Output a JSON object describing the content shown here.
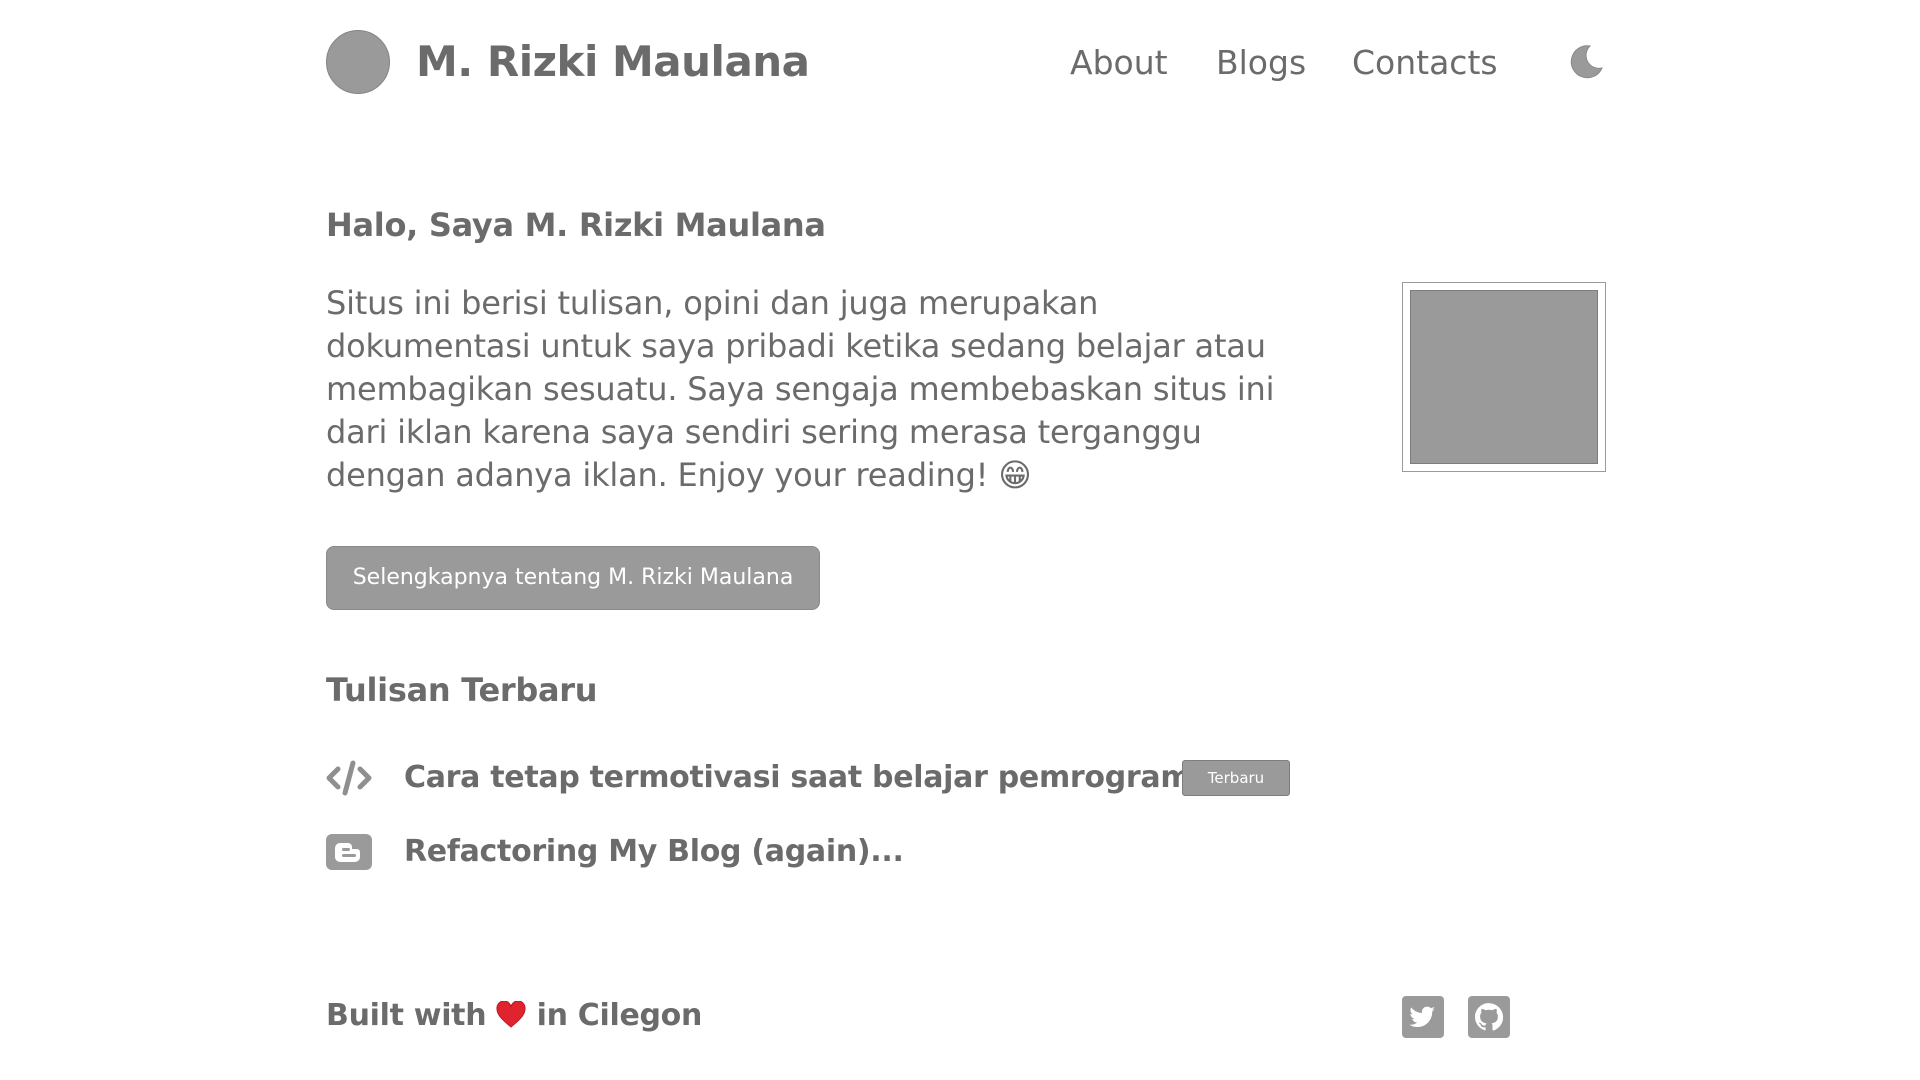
{
  "header": {
    "site_title": "M. Rizki Maulana",
    "nav": {
      "about": "About",
      "blogs": "Blogs",
      "contacts": "Contacts"
    },
    "theme_toggle_icon": "moon-icon"
  },
  "intro": {
    "heading": "Halo, Saya M. Rizki Maulana",
    "text": "Situs ini berisi tulisan, opini dan juga merupakan dokumentasi untuk saya pribadi ketika sedang belajar atau membagikan sesuatu. Saya sengaja membebaskan situs ini dari iklan karena saya sendiri sering merasa terganggu dengan adanya iklan. Enjoy your reading!",
    "emoji": "😁",
    "button_label": "Selengkapnya tentang M. Rizki Maulana"
  },
  "recent": {
    "heading": "Tulisan Terbaru",
    "posts": [
      {
        "icon": "code-icon",
        "title": "Cara tetap termotivasi saat belajar pemrograman",
        "badge": "Terbaru"
      },
      {
        "icon": "blogger-icon",
        "title": "Refactoring My Blog (again)..."
      }
    ]
  },
  "footer": {
    "text_before": "Built with",
    "text_after": "in Cilegon",
    "heart_icon": "heart-icon",
    "social": [
      "twitter-icon",
      "github-icon"
    ]
  },
  "colors": {
    "text": "#6b6b6b",
    "placeholder_gray": "#9a9a9a",
    "heart": "#e0232e"
  }
}
